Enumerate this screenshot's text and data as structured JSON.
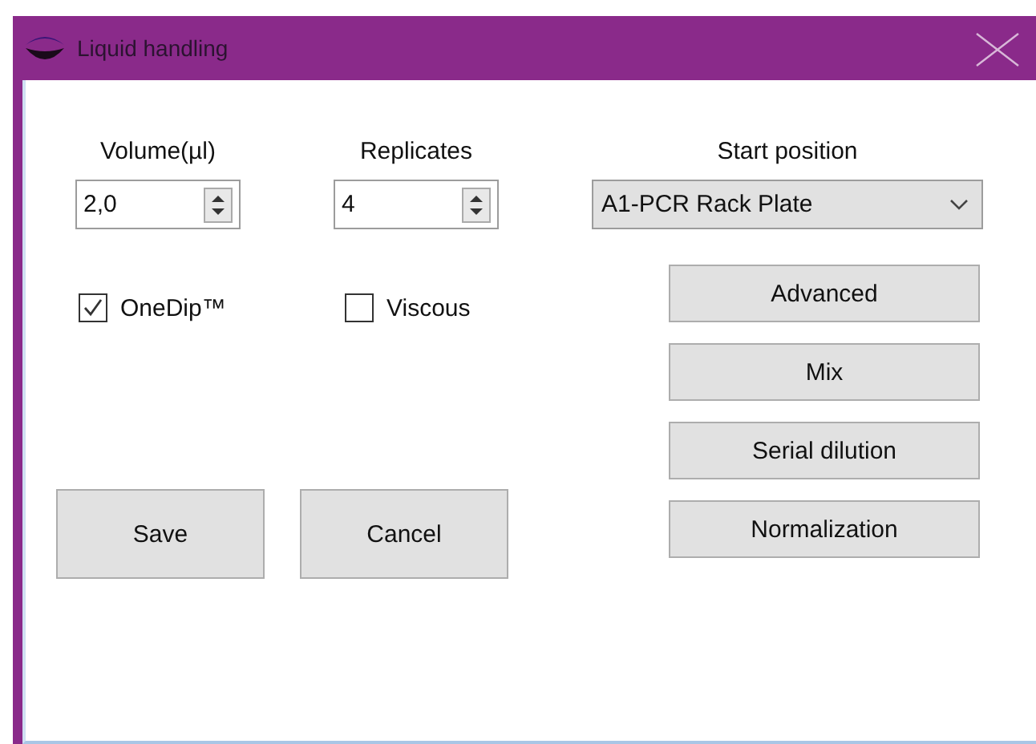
{
  "window": {
    "title": "Liquid handling"
  },
  "fields": [
    {
      "label": "Volume(µl)",
      "value": "2,0"
    },
    {
      "label": "Replicates",
      "value": "4"
    }
  ],
  "start_position": {
    "label": "Start position",
    "value": "A1-PCR Rack Plate"
  },
  "checkboxes": [
    {
      "label": "OneDip™",
      "checked": true
    },
    {
      "label": "Viscous",
      "checked": false
    }
  ],
  "option_buttons": [
    "Advanced",
    "Mix",
    "Serial dilution",
    "Normalization"
  ],
  "buttons": [
    "Save",
    "Cancel"
  ]
}
